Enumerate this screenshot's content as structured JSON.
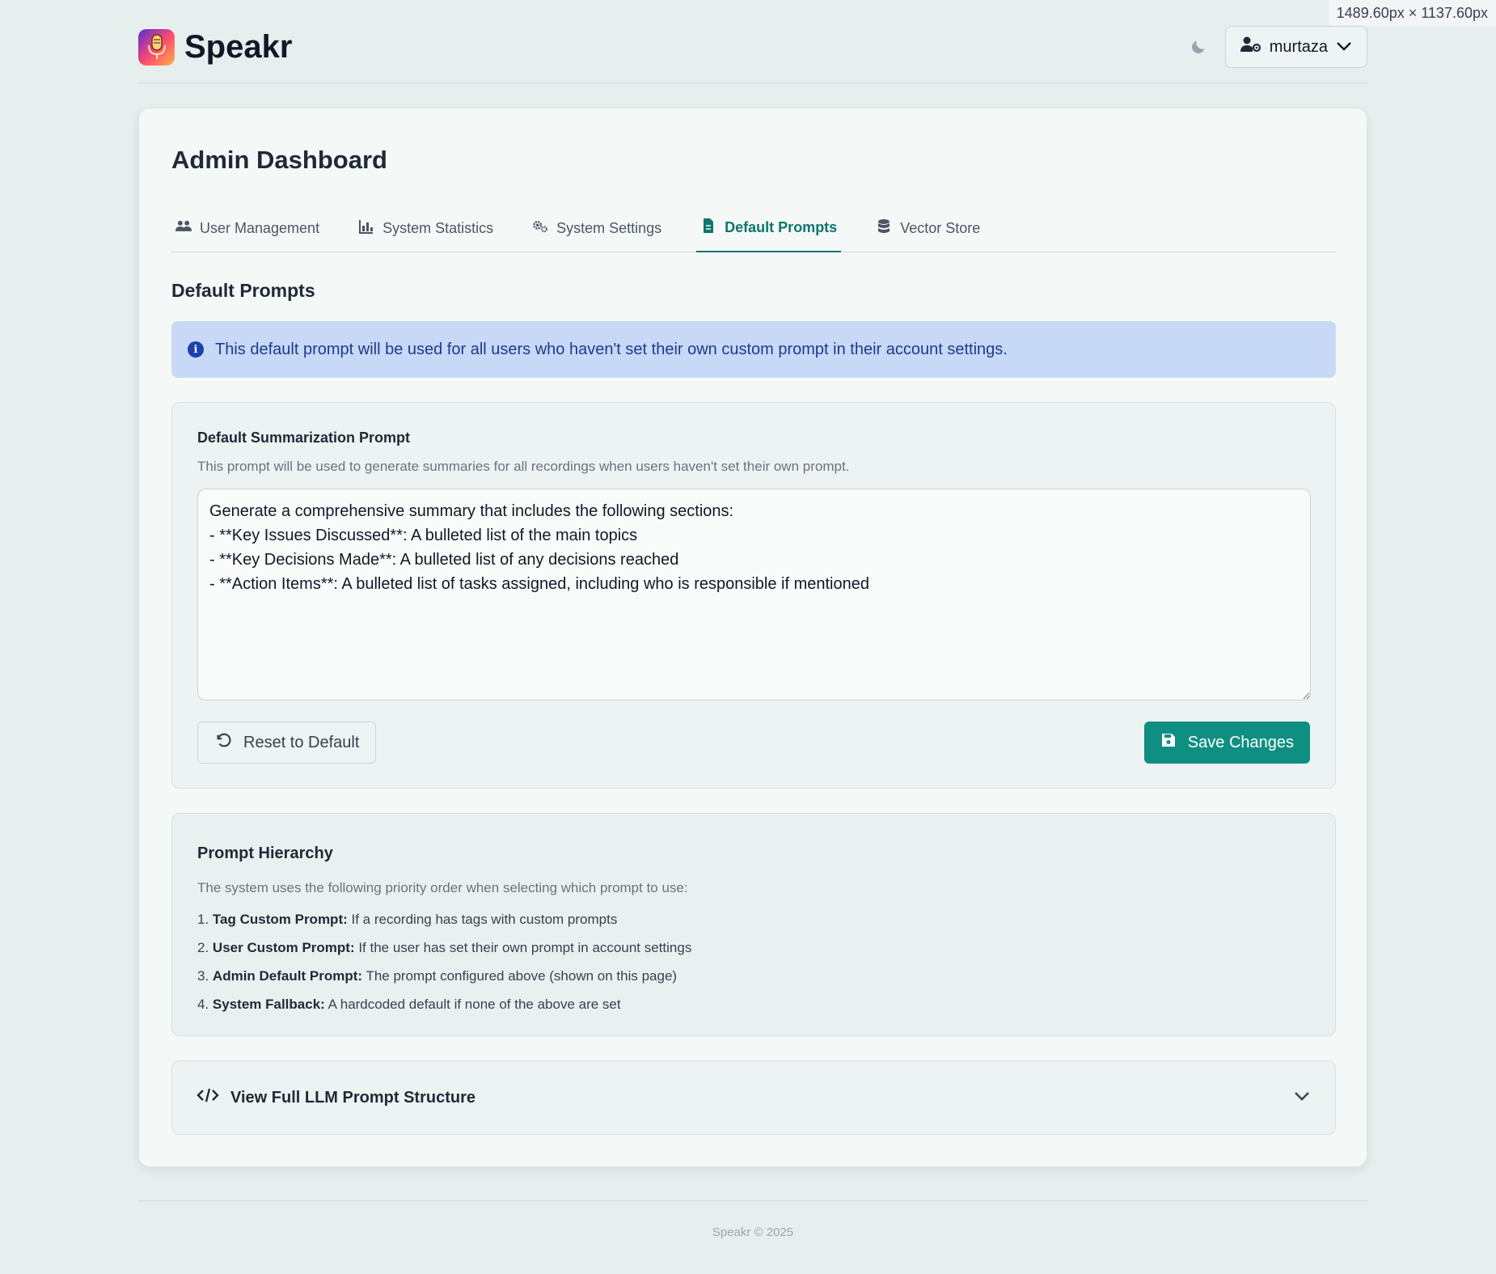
{
  "viewport_readout": "1489.60px × 1137.60px",
  "header": {
    "brand_name": "Speakr",
    "theme_icon": "moon-icon",
    "user_name": "murtaza"
  },
  "page": {
    "title": "Admin Dashboard"
  },
  "tabs": [
    {
      "label": "User Management",
      "icon": "users-icon",
      "active": false
    },
    {
      "label": "System Statistics",
      "icon": "chart-icon",
      "active": false
    },
    {
      "label": "System Settings",
      "icon": "gears-icon",
      "active": false
    },
    {
      "label": "Default Prompts",
      "icon": "file-icon",
      "active": true
    },
    {
      "label": "Vector Store",
      "icon": "database-icon",
      "active": false
    }
  ],
  "section": {
    "title": "Default Prompts",
    "info_text": "This default prompt will be used for all users who haven't set their own custom prompt in their account settings."
  },
  "prompt": {
    "label": "Default Summarization Prompt",
    "help": "This prompt will be used to generate summaries for all recordings when users haven't set their own prompt.",
    "value": "Generate a comprehensive summary that includes the following sections:\n- **Key Issues Discussed**: A bulleted list of the main topics\n- **Key Decisions Made**: A bulleted list of any decisions reached\n- **Action Items**: A bulleted list of tasks assigned, including who is responsible if mentioned",
    "reset_label": "Reset to Default",
    "save_label": "Save Changes"
  },
  "hierarchy": {
    "title": "Prompt Hierarchy",
    "intro": "The system uses the following priority order when selecting which prompt to use:",
    "items": [
      {
        "num": "1.",
        "name": "Tag Custom Prompt:",
        "desc": " If a recording has tags with custom prompts"
      },
      {
        "num": "2.",
        "name": "User Custom Prompt:",
        "desc": " If the user has set their own prompt in account settings"
      },
      {
        "num": "3.",
        "name": "Admin Default Prompt:",
        "desc": " The prompt configured above (shown on this page)"
      },
      {
        "num": "4.",
        "name": "System Fallback:",
        "desc": " A hardcoded default if none of the above are set"
      }
    ]
  },
  "expander": {
    "label": "View Full LLM Prompt Structure",
    "icon": "code-icon"
  },
  "footer": {
    "text": "Speakr © 2025"
  },
  "colors": {
    "accent": "#0f8f82",
    "active_tab": "#0f766e",
    "info_bg": "#c7d9f7",
    "info_text": "#1e3a8a",
    "page_bg": "#e7efee"
  }
}
